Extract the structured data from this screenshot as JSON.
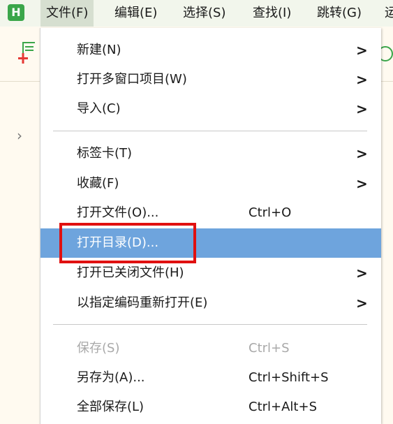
{
  "app": {
    "logo_letter": "H"
  },
  "menubar": {
    "items": [
      {
        "label": "文件(F)"
      },
      {
        "label": "编辑(E)"
      },
      {
        "label": "选择(S)"
      },
      {
        "label": "查找(I)"
      },
      {
        "label": "跳转(G)"
      },
      {
        "label": "运"
      }
    ]
  },
  "icons": {
    "chevron": "›",
    "arrow": ">"
  },
  "file_menu": {
    "items": [
      {
        "label": "新建(N)",
        "has_submenu": true
      },
      {
        "label": "打开多窗口项目(W)",
        "has_submenu": true
      },
      {
        "label": "导入(C)",
        "has_submenu": true
      },
      {
        "label": "标签卡(T)",
        "has_submenu": true
      },
      {
        "label": "收藏(F)",
        "has_submenu": true
      },
      {
        "label": "打开文件(O)...",
        "shortcut": "Ctrl+O"
      },
      {
        "label": "打开目录(D)...",
        "highlighted": true
      },
      {
        "label": "打开已关闭文件(H)",
        "has_submenu": true
      },
      {
        "label": "以指定编码重新打开(E)",
        "has_submenu": true
      },
      {
        "label": "保存(S)",
        "shortcut": "Ctrl+S",
        "disabled": true
      },
      {
        "label": "另存为(A)...",
        "shortcut": "Ctrl+Shift+S"
      },
      {
        "label": "全部保存(L)",
        "shortcut": "Ctrl+Alt+S"
      }
    ]
  },
  "colors": {
    "highlight": "#6ea4dd",
    "annotation_box": "#e01010",
    "brand": "#3aa64a"
  }
}
